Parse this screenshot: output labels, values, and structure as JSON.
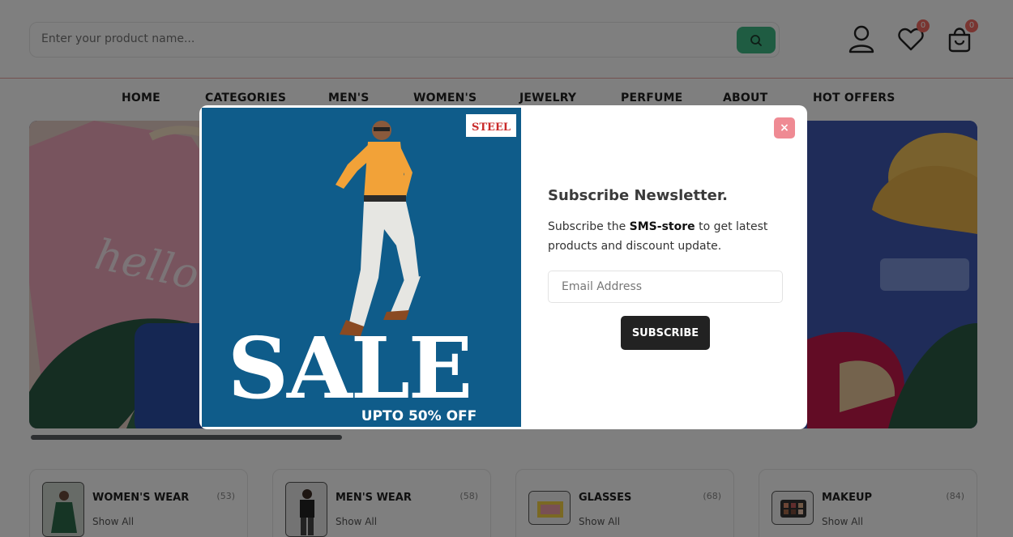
{
  "search": {
    "placeholder": "Enter your product name..."
  },
  "header": {
    "wishlist_count": "0",
    "cart_count": "0"
  },
  "nav": [
    "HOME",
    "CATEGORIES",
    "MEN'S",
    "WOMEN'S",
    "JEWELRY",
    "PERFUME",
    "ABOUT",
    "HOT OFFERS"
  ],
  "banner": {
    "hello_text": "hello"
  },
  "categories": [
    {
      "title": "WOMEN'S WEAR",
      "count": "(53)",
      "link": "Show All"
    },
    {
      "title": "MEN'S WEAR",
      "count": "(58)",
      "link": "Show All"
    },
    {
      "title": "GLASSES",
      "count": "(68)",
      "link": "Show All"
    },
    {
      "title": "MAKEUP",
      "count": "(84)",
      "link": "Show All"
    }
  ],
  "modal": {
    "close": "×",
    "image": {
      "brand": "STEEL",
      "sale": "SALE",
      "offer": "UPTO 50% OFF"
    },
    "title": "Subscribe Newsletter.",
    "text_pre": "Subscribe the ",
    "text_bold": "SMS-store",
    "text_post": " to get latest products and discount update.",
    "email_placeholder": "Email Address",
    "subscribe_label": "SUBSCRIBE"
  },
  "colors": {
    "accent_green": "#3fb985",
    "badge_red": "#f26a63",
    "close_pink": "#ef8a93"
  }
}
